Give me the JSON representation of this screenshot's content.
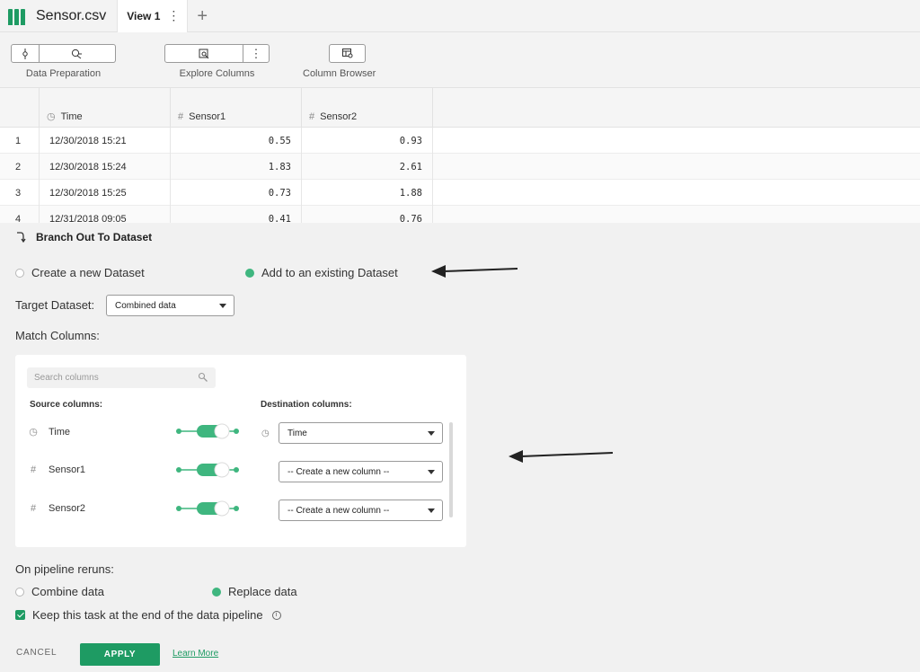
{
  "app": {
    "file_title": "Sensor.csv",
    "tabs": [
      {
        "label": "View 1"
      }
    ]
  },
  "toolbar": {
    "groups": [
      {
        "label": "Data Preparation"
      },
      {
        "label": "Explore Columns"
      },
      {
        "label": "Column Browser"
      }
    ]
  },
  "grid": {
    "columns": [
      {
        "label": "Time",
        "icon": "clock-icon"
      },
      {
        "label": "Sensor1",
        "icon": "hash-icon"
      },
      {
        "label": "Sensor2",
        "icon": "hash-icon"
      }
    ],
    "rows": [
      {
        "num": "1",
        "time": "12/30/2018 15:21",
        "sensor1": "0.55",
        "sensor2": "0.93"
      },
      {
        "num": "2",
        "time": "12/30/2018 15:24",
        "sensor1": "1.83",
        "sensor2": "2.61"
      },
      {
        "num": "3",
        "time": "12/30/2018 15:25",
        "sensor1": "0.73",
        "sensor2": "1.88"
      },
      {
        "num": "4",
        "time": "12/31/2018 09:05",
        "sensor1": "0.41",
        "sensor2": "0.76"
      }
    ]
  },
  "panel": {
    "title": "Branch Out To Dataset",
    "mode_options": [
      {
        "label": "Create a new Dataset",
        "selected": false
      },
      {
        "label": "Add to an existing Dataset",
        "selected": true
      }
    ],
    "target_dataset": {
      "label": "Target Dataset:",
      "value": "Combined data"
    },
    "match_columns": {
      "label": "Match Columns:",
      "search_placeholder": "Search columns",
      "source_header": "Source columns:",
      "destination_header": "Destination columns:",
      "mappings": [
        {
          "source": "Time",
          "source_icon": "clock-icon",
          "destination": "Time",
          "destination_icon": "clock-icon",
          "enabled": true
        },
        {
          "source": "Sensor1",
          "source_icon": "hash-icon",
          "destination": "-- Create a new column --",
          "enabled": true
        },
        {
          "source": "Sensor2",
          "source_icon": "hash-icon",
          "destination": "-- Create a new column --",
          "enabled": true
        }
      ]
    },
    "reruns": {
      "label": "On pipeline reruns:",
      "options": [
        {
          "label": "Combine data",
          "selected": false
        },
        {
          "label": "Replace data",
          "selected": true
        }
      ]
    },
    "keep_at_end": {
      "label": "Keep this task at the end of the data pipeline",
      "checked": true
    },
    "actions": {
      "cancel": "CANCEL",
      "apply": "APPLY",
      "learn_more": "Learn More"
    }
  },
  "colors": {
    "accent": "#1e9b63",
    "toggle": "#3fb67f"
  }
}
